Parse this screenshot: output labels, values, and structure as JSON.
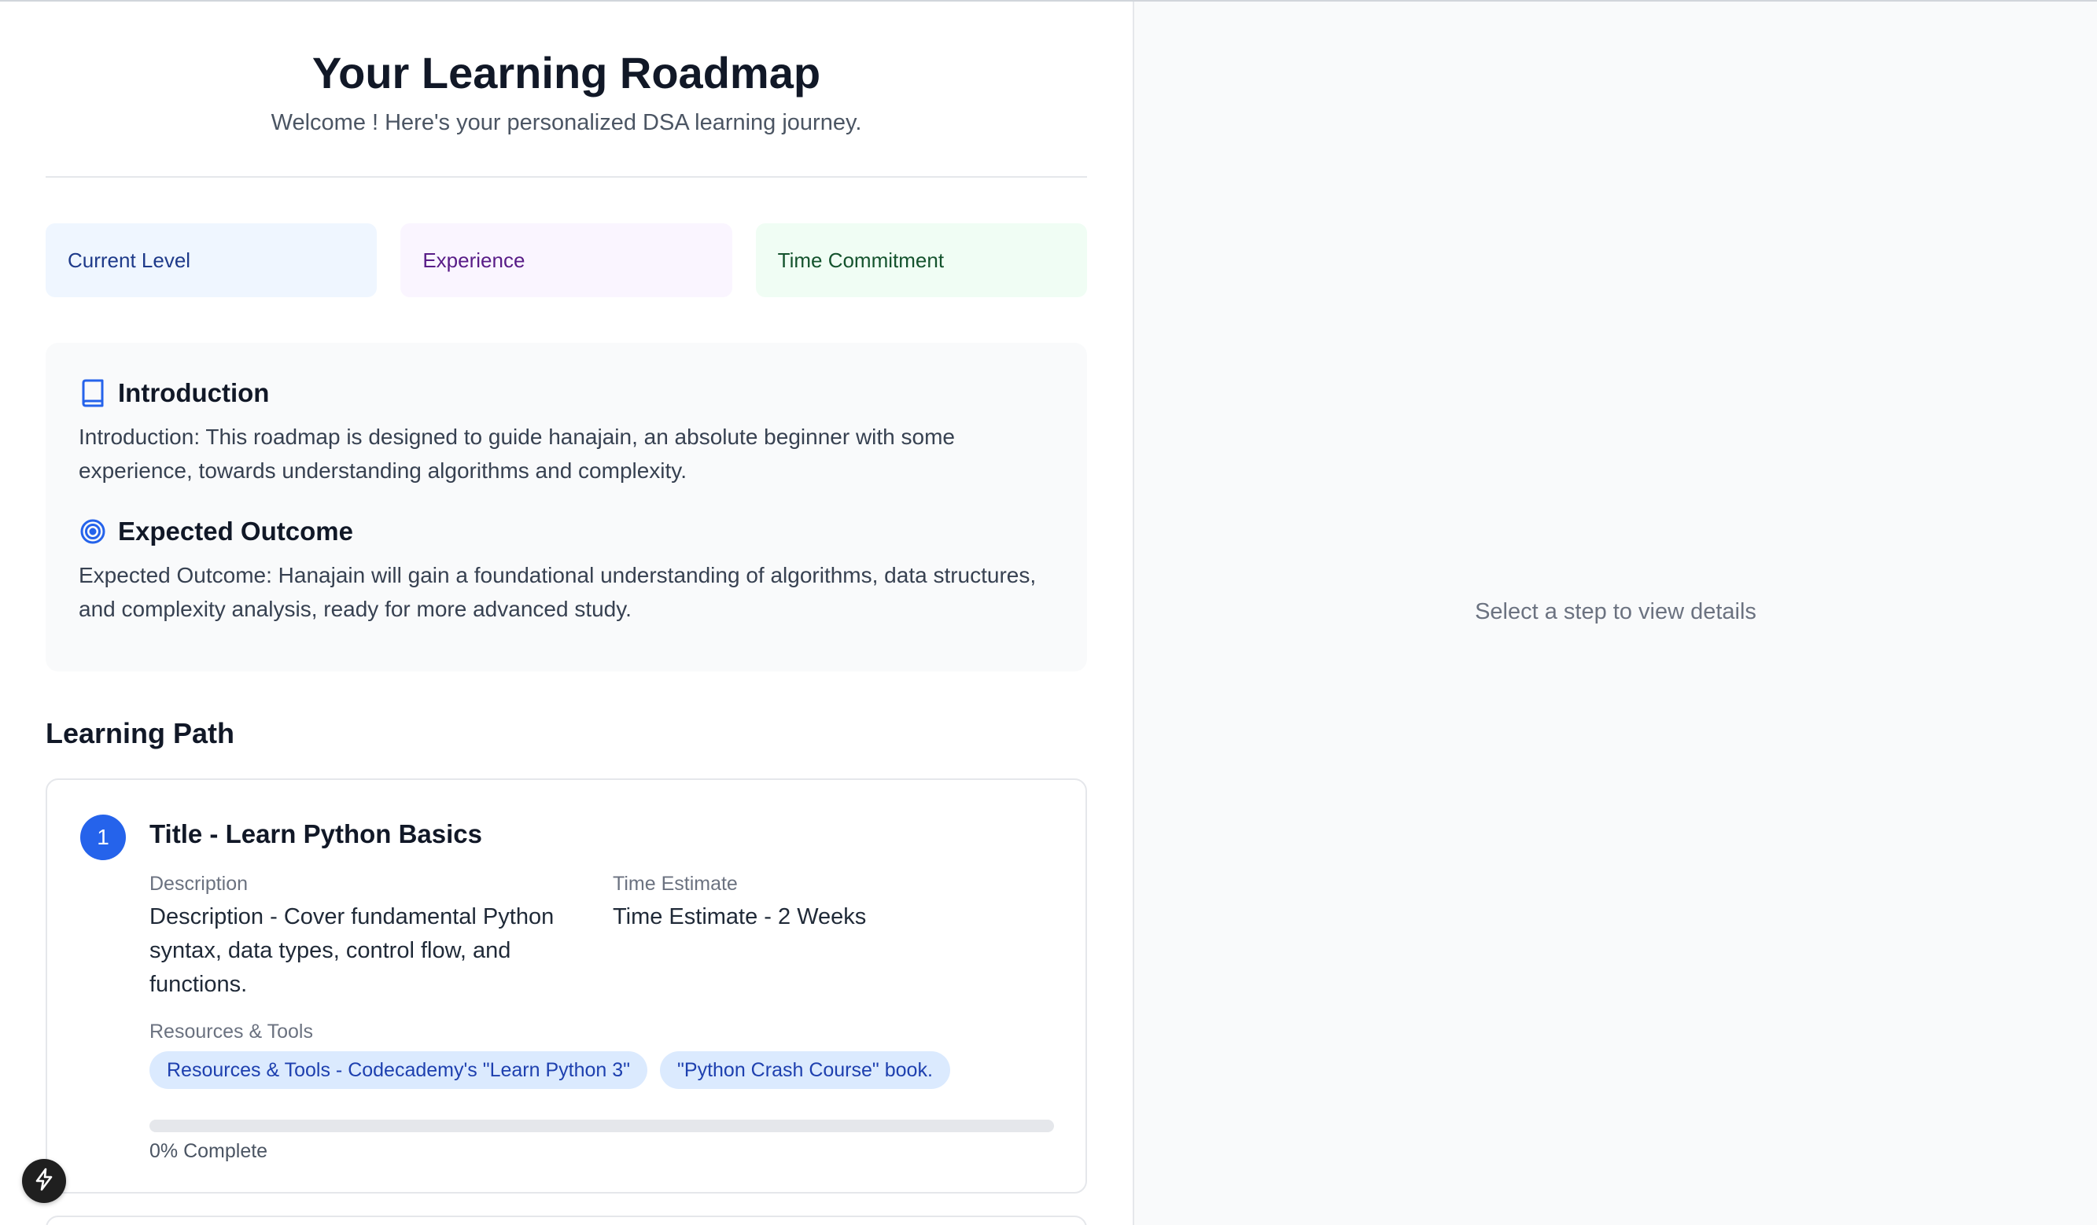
{
  "header": {
    "title": "Your Learning Roadmap",
    "subtitle": "Welcome ! Here's your personalized DSA learning journey."
  },
  "stats": [
    {
      "label": "Current Level",
      "color": "#eff6ff"
    },
    {
      "label": "Experience",
      "color": "#faf5ff"
    },
    {
      "label": "Time Commitment",
      "color": "#f0fdf4"
    }
  ],
  "overview": {
    "introduction": {
      "heading": "Introduction",
      "icon": "book-icon",
      "text": "Introduction: This roadmap is designed to guide hanajain, an absolute beginner with some experience, towards understanding algorithms and complexity."
    },
    "outcome": {
      "heading": "Expected Outcome",
      "icon": "target-icon",
      "text": "Expected Outcome: Hanajain will gain a foundational understanding of algorithms, data structures, and complexity analysis, ready for more advanced study."
    }
  },
  "learning_path": {
    "title": "Learning Path",
    "steps": [
      {
        "number": "1",
        "title": "Title - Learn Python Basics",
        "description_label": "Description",
        "description": "Description - Cover fundamental Python syntax, data types, control flow, and functions.",
        "time_label": "Time Estimate",
        "time": "Time Estimate - 2 Weeks",
        "resources_label": "Resources & Tools",
        "resources": [
          "Resources & Tools - Codecademy's \"Learn Python 3\"",
          "\"Python Crash Course\" book."
        ],
        "progress_percent": 0,
        "progress_label": "0% Complete"
      }
    ]
  },
  "detail_panel": {
    "placeholder": "Select a step to view details"
  },
  "colors": {
    "accent": "#2563eb",
    "tag_bg": "#dbeafe",
    "tag_text": "#1e40af"
  }
}
